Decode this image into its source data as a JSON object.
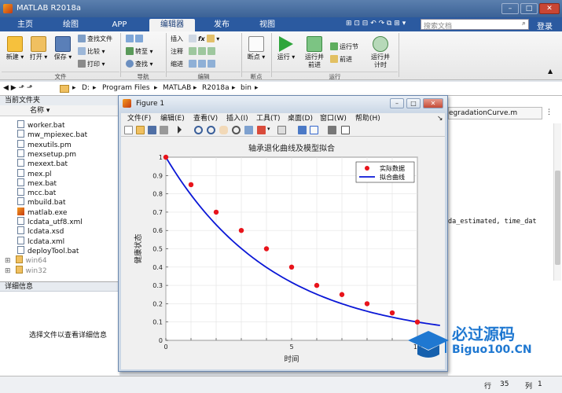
{
  "app": {
    "title": "MATLAB R2018a"
  },
  "tabs": [
    {
      "label": "主页"
    },
    {
      "label": "绘图"
    },
    {
      "label": "APP"
    },
    {
      "label": "编辑器"
    },
    {
      "label": "发布"
    },
    {
      "label": "视图"
    }
  ],
  "search": {
    "placeholder": "搜索文档"
  },
  "login": "登录",
  "ribbon": {
    "new": "新建",
    "open": "打开",
    "save": "保存",
    "find_files": "查找文件",
    "compare": "比较",
    "print": "打印",
    "goto": "转至",
    "find": "查找",
    "insert": "插入",
    "comment": "注释",
    "indent": "缩进",
    "breakpoint": "断点",
    "run": "运行",
    "run_advance_1": "运行并",
    "run_advance_2": "前进",
    "run_section": "运行节",
    "advance": "前进",
    "run_time_1": "运行并",
    "run_time_2": "计时",
    "groups": {
      "file": "文件",
      "navigate": "导航",
      "edit": "编辑",
      "breakpoints": "断点",
      "run": "运行"
    }
  },
  "address": {
    "crumbs": [
      "D:",
      "Program Files",
      "MATLAB",
      "R2018a",
      "bin"
    ]
  },
  "current_folder": {
    "title": "当前文件夹",
    "col_name": "名称",
    "files": [
      "worker.bat",
      "mw_mpiexec.bat",
      "mexutils.pm",
      "mexsetup.pm",
      "mexext.bat",
      "mex.pl",
      "mex.bat",
      "mcc.bat",
      "mbuild.bat",
      "matlab.exe",
      "lcdata_utf8.xml",
      "lcdata.xsd",
      "lcdata.xml",
      "deployTool.bat"
    ],
    "folders": [
      "win64",
      "win32"
    ]
  },
  "details": {
    "title": "详细信息",
    "hint": "选择文件以查看详细信息"
  },
  "editor": {
    "tab": "egradationCurve.m",
    "code": "da_estimated, time_dat"
  },
  "figure": {
    "title": "Figure 1",
    "menu": [
      "文件(F)",
      "编辑(E)",
      "查看(V)",
      "插入(I)",
      "工具(T)",
      "桌面(D)",
      "窗口(W)",
      "帮助(H)"
    ]
  },
  "statusbar": {
    "row_label": "行",
    "row": "35",
    "col_label": "列",
    "col": "1"
  },
  "watermark": {
    "line1": "必过源码",
    "line2": "Biguo100.CN"
  },
  "chart_data": {
    "type": "line",
    "title": "轴承退化曲线及模型拟合",
    "xlabel": "时间",
    "ylabel": "健康状态",
    "xlim": [
      0,
      10
    ],
    "ylim": [
      0,
      1
    ],
    "xticks": [
      "0",
      "5",
      "10"
    ],
    "yticks": [
      "0",
      "0.1",
      "0.2",
      "0.3",
      "0.4",
      "0.5",
      "0.6",
      "0.7",
      "0.8",
      "0.9",
      "1"
    ],
    "grid": true,
    "legend_position": "top-right",
    "series": [
      {
        "name": "实际数据",
        "kind": "scatter",
        "color": "#e8141b",
        "x": [
          0,
          1,
          2,
          3,
          4,
          5,
          6,
          7,
          8,
          9,
          10
        ],
        "y": [
          1,
          0.85,
          0.7,
          0.6,
          0.5,
          0.4,
          0.3,
          0.25,
          0.2,
          0.15,
          0.1
        ]
      },
      {
        "name": "拟合曲线",
        "kind": "line",
        "color": "#0a17d6",
        "model": "y = exp(-0.23*x)",
        "x_max": 10.9
      }
    ]
  }
}
